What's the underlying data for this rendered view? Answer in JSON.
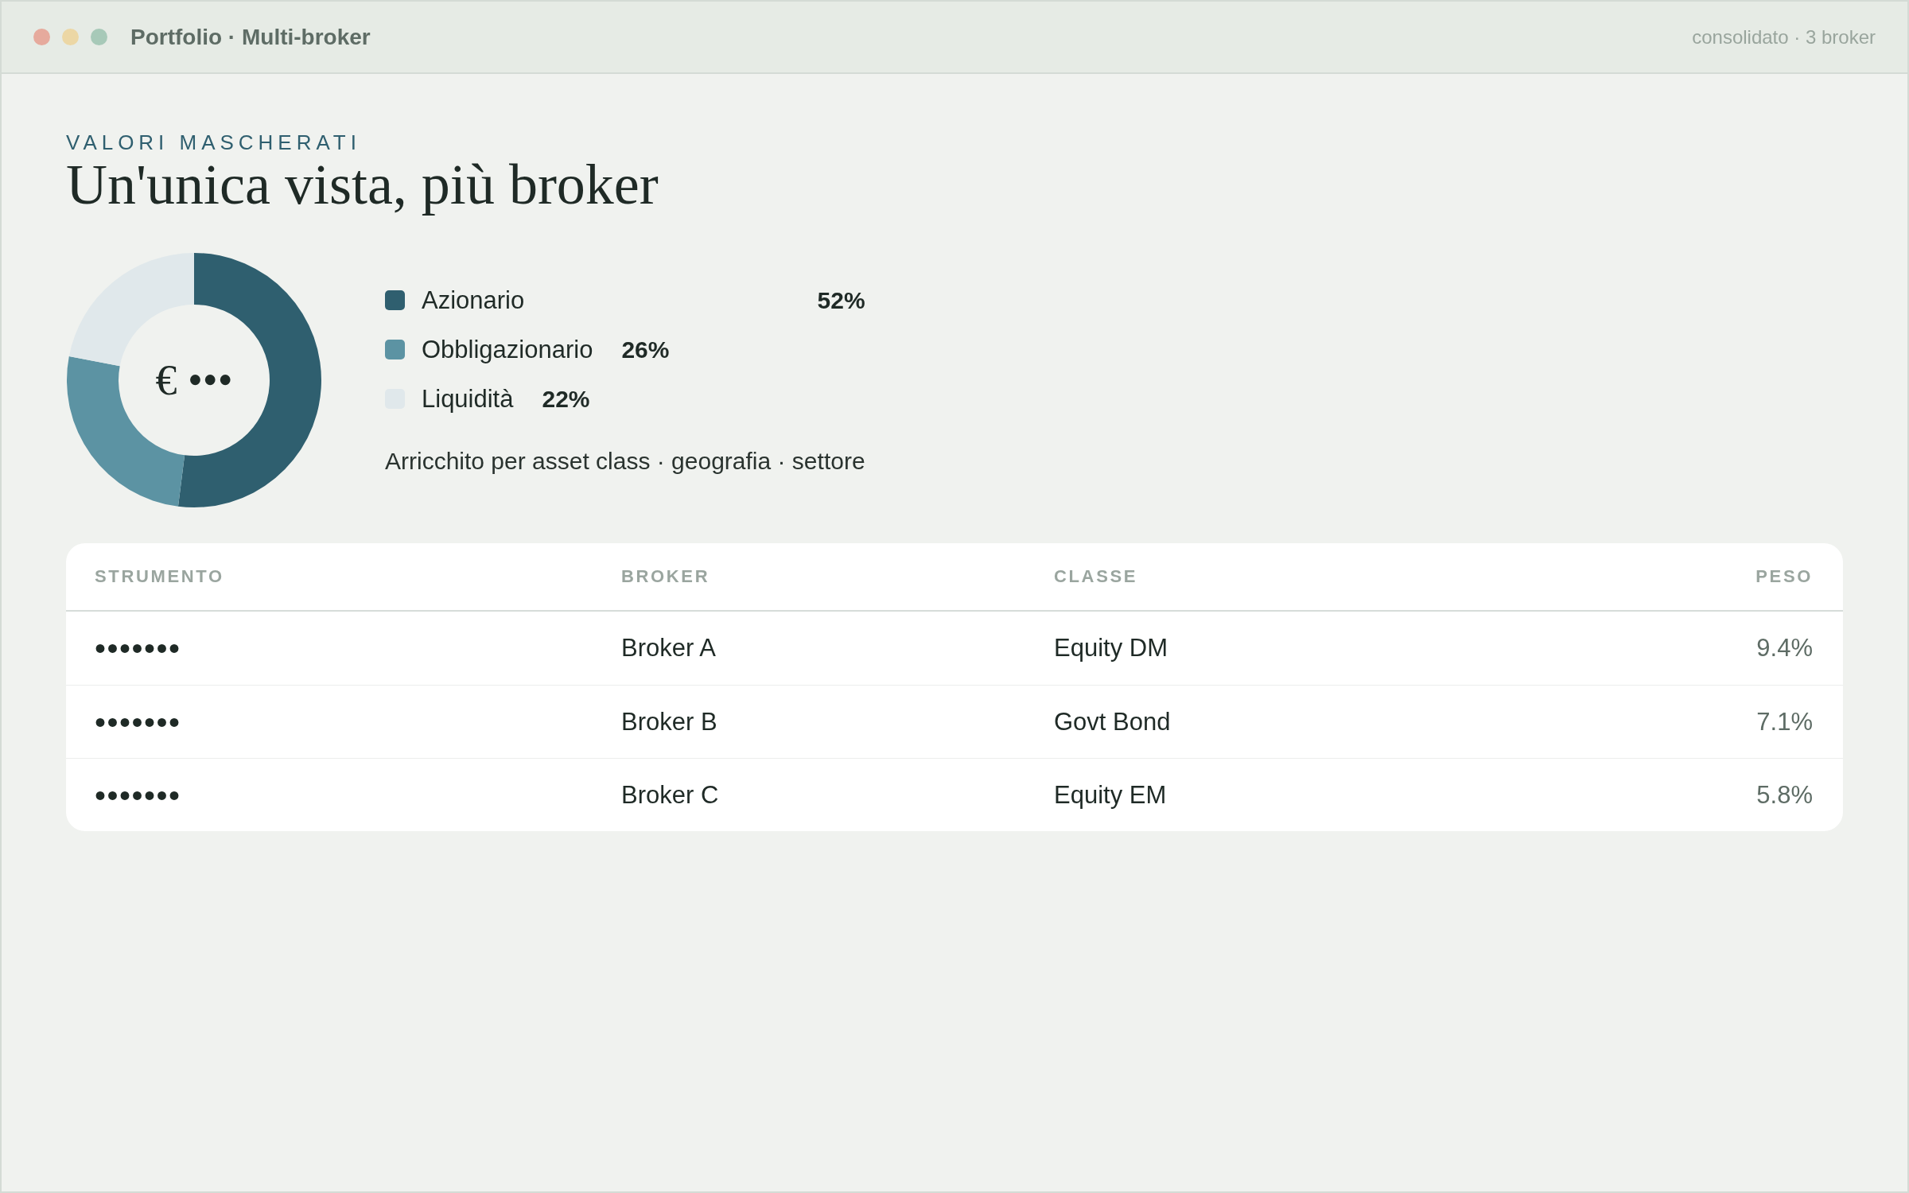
{
  "window": {
    "title": "Portfolio · Multi-broker",
    "subtitle": "consolidato · 3 broker"
  },
  "header": {
    "eyebrow": "VALORI MASCHERATI",
    "title": "Un'unica vista, più broker"
  },
  "allocation": {
    "center_label": "€ •••",
    "chart_data": {
      "type": "donut",
      "values": [
        52,
        26,
        22
      ]
    },
    "legend": [
      {
        "label": "Azionario",
        "share": "52%",
        "color": "#2f5f6f"
      },
      {
        "label": "Obbligazionario",
        "share": "26%",
        "color": "#5c93a3"
      },
      {
        "label": "Liquidità",
        "share": "22%",
        "color": "#e0e8eb"
      }
    ],
    "caption": "Arricchito per asset class · geografia · settore"
  },
  "table": {
    "columns": [
      "STRUMENTO",
      "BROKER",
      "CLASSE",
      "PESO"
    ],
    "rows": [
      [
        "•••••••",
        "Broker A",
        "Equity DM",
        "9.4%"
      ],
      [
        "•••••••",
        "Broker B",
        "Govt Bond",
        "7.1%"
      ],
      [
        "•••••••",
        "Broker C",
        "Equity EM",
        "5.8%"
      ]
    ]
  }
}
